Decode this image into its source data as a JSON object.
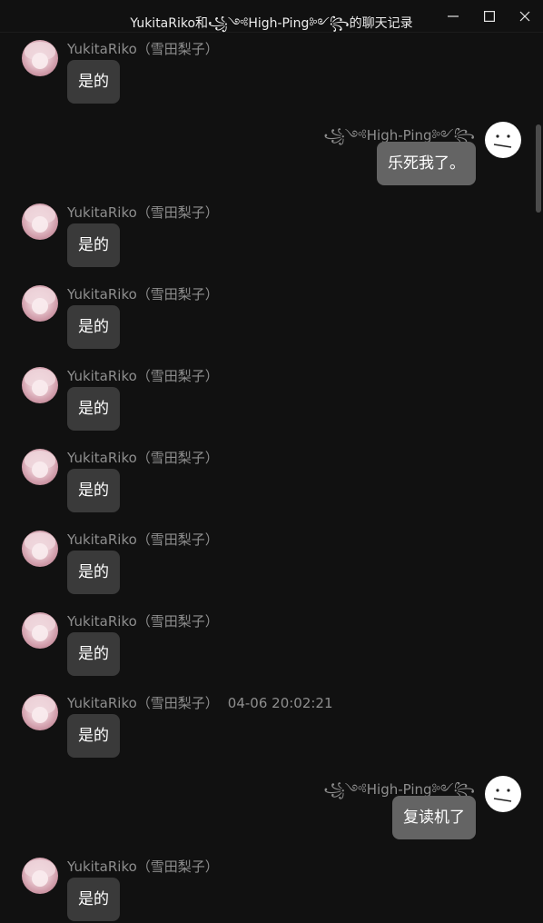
{
  "window": {
    "title": "YukitaRiko和꧁༺High-Ping༻꧂的聊天记录",
    "buttons": [
      "minimize-icon",
      "maximize-icon",
      "close-icon"
    ]
  },
  "users": {
    "yukita": {
      "display_name": "YukitaRiko（雪田梨子）",
      "avatar": "anime-girl-avatar"
    },
    "highping": {
      "display_name": "꧁༺High-Ping༻꧂",
      "avatar": "neutral-face-avatar"
    }
  },
  "messages": [
    {
      "sender": "YukitaRiko（雪田梨子）",
      "text": "是的",
      "side": "left",
      "time": ""
    },
    {
      "sender": "꧁༺High-Ping༻꧂",
      "text": "乐死我了。",
      "side": "right",
      "time": ""
    },
    {
      "sender": "YukitaRiko（雪田梨子）",
      "text": "是的",
      "side": "left",
      "time": ""
    },
    {
      "sender": "YukitaRiko（雪田梨子）",
      "text": "是的",
      "side": "left",
      "time": ""
    },
    {
      "sender": "YukitaRiko（雪田梨子）",
      "text": "是的",
      "side": "left",
      "time": ""
    },
    {
      "sender": "YukitaRiko（雪田梨子）",
      "text": "是的",
      "side": "left",
      "time": ""
    },
    {
      "sender": "YukitaRiko（雪田梨子）",
      "text": "是的",
      "side": "left",
      "time": ""
    },
    {
      "sender": "YukitaRiko（雪田梨子）",
      "text": "是的",
      "side": "left",
      "time": ""
    },
    {
      "sender": "YukitaRiko（雪田梨子）",
      "text": "是的",
      "side": "left",
      "time": "04-06 20:02:21"
    },
    {
      "sender": "꧁༺High-Ping༻꧂",
      "text": "复读机了",
      "side": "right",
      "time": ""
    },
    {
      "sender": "YukitaRiko（雪田梨子）",
      "text": "是的",
      "side": "left",
      "time": ""
    }
  ],
  "colors": {
    "background": "#111111",
    "left_bubble": "#3a3a3a",
    "right_bubble": "#646464",
    "meta_text": "#8e8e8e"
  }
}
